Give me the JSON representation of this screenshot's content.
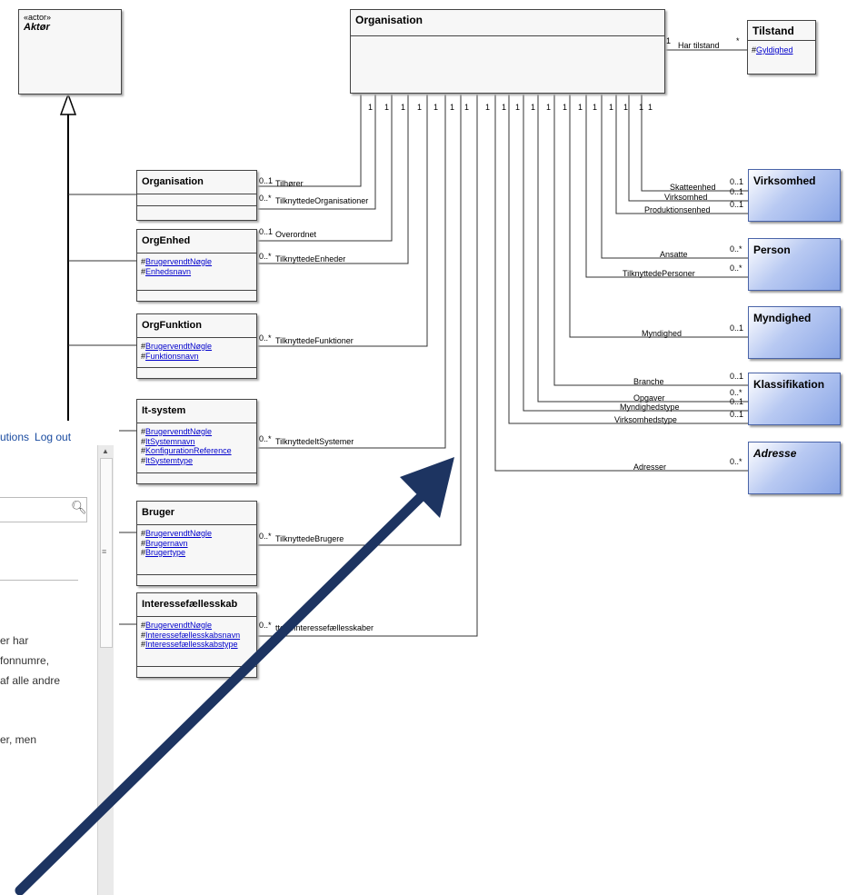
{
  "actor": {
    "stereotype": "«actor»",
    "name": "Aktør"
  },
  "organisation_main": {
    "title": "Organisation"
  },
  "tilstand": {
    "title": "Tilstand",
    "attr_prefix": "#",
    "attr": "Gyldighed",
    "rel_label": "Har tilstand",
    "mult_left": "1",
    "mult_right": "*"
  },
  "one_mults": [
    "1",
    "1",
    "1",
    "1",
    "1",
    "1",
    "1",
    "1",
    "1",
    "1",
    "1",
    "1",
    "1",
    "1",
    "1",
    "1",
    "1",
    "1",
    "1",
    "1"
  ],
  "left_classes": [
    {
      "title": "Organisation",
      "attrs": [],
      "assoc": [
        {
          "mult": "0..1",
          "label": "Tilhører"
        },
        {
          "mult": "0..*",
          "label": "TilknyttedeOrganisationer"
        }
      ]
    },
    {
      "title": "OrgEnhed",
      "attrs": [
        "BrugervendtNøgle",
        "Enhedsnavn"
      ],
      "assoc": [
        {
          "mult": "0..1",
          "label": "Overordnet"
        },
        {
          "mult": "0..*",
          "label": "TilknyttedeEnheder"
        }
      ]
    },
    {
      "title": "OrgFunktion",
      "attrs": [
        "BrugervendtNøgle",
        "Funktionsnavn"
      ],
      "assoc": [
        {
          "mult": "0..*",
          "label": "TilknyttedeFunktioner"
        }
      ]
    },
    {
      "title": "It-system",
      "attrs": [
        "BrugervendtNøgle",
        "ItSystemnavn",
        "KonfigurationReference",
        "ItSystemtype"
      ],
      "assoc": [
        {
          "mult": "0..*",
          "label": "TilknyttedeItSystemer"
        }
      ]
    },
    {
      "title": "Bruger",
      "attrs": [
        "BrugervendtNøgle",
        "Brugernavn",
        "Brugertype"
      ],
      "assoc": [
        {
          "mult": "0..*",
          "label": "TilknyttedeBrugere"
        }
      ]
    },
    {
      "title": "Interessefællesskab",
      "attrs": [
        "BrugervendtNøgle",
        "Interessefællesskabsnavn",
        "Interessefællesskabstype"
      ],
      "assoc": [
        {
          "mult": "0..*",
          "label": "ttedeInteressefællesskaber"
        }
      ]
    }
  ],
  "right_classes": [
    {
      "title": "Virksomhed",
      "italic": false,
      "rels": [
        {
          "label": "Skatteenhed",
          "mult": "0..1"
        },
        {
          "label": "Virksomhed",
          "mult": "0..1"
        },
        {
          "label": "Produktionsenhed",
          "mult": "0..1"
        }
      ]
    },
    {
      "title": "Person",
      "italic": false,
      "rels": [
        {
          "label": "Ansatte",
          "mult": "0..*"
        },
        {
          "label": "TilknyttedePersoner",
          "mult": "0..*"
        }
      ]
    },
    {
      "title": "Myndighed",
      "italic": false,
      "rels": [
        {
          "label": "Myndighed",
          "mult": "0..1"
        }
      ]
    },
    {
      "title": "Klassifikation",
      "italic": false,
      "rels": [
        {
          "label": "Branche",
          "mult": "0..1"
        },
        {
          "label": "Opgaver",
          "mult": "0..*"
        },
        {
          "label": "Myndighedstype",
          "mult": "0..1"
        },
        {
          "label": "Virksomhedstype",
          "mult": "0..1"
        }
      ]
    },
    {
      "title": "Adresse",
      "italic": true,
      "rels": [
        {
          "label": "Adresser",
          "mult": "0..*"
        }
      ]
    }
  ],
  "browser": {
    "toplinks": [
      "utions",
      "Log out"
    ],
    "paragraph": [
      "er har",
      "fonnumre,",
      "af alle andre",
      "",
      "er, men"
    ]
  },
  "colors": {
    "arrow": "#1d3461",
    "link": "#0000cc",
    "blue_box": "#8aa6e6"
  },
  "icons": {
    "search": "search-icon",
    "arrow": "big-arrow",
    "generalization": "inheritance-arrowhead"
  }
}
